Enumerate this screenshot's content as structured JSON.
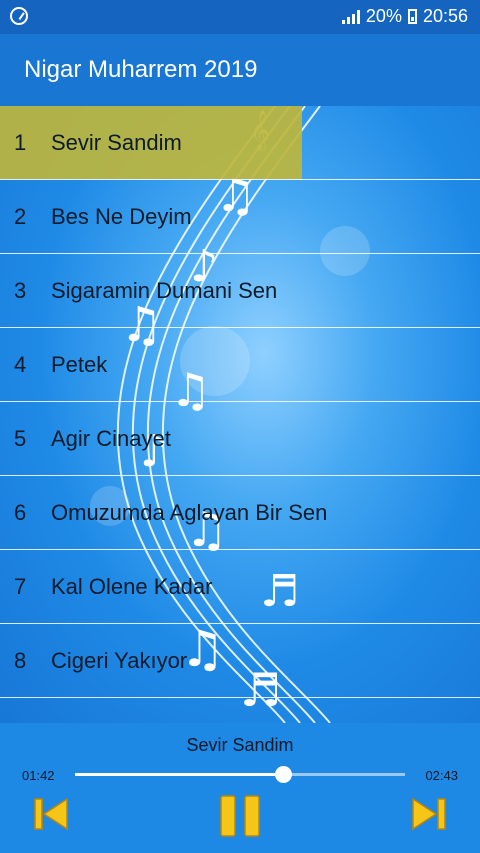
{
  "status_bar": {
    "battery_text": "20%",
    "time": "20:56"
  },
  "app_bar": {
    "title": "Nigar Muharrem 2019"
  },
  "tracks": [
    {
      "num": "1",
      "title": "Sevir Sandim",
      "active": true
    },
    {
      "num": "2",
      "title": "Bes Ne Deyim",
      "active": false
    },
    {
      "num": "3",
      "title": "Sigaramin Dumani Sen",
      "active": false
    },
    {
      "num": "4",
      "title": "Petek",
      "active": false
    },
    {
      "num": "5",
      "title": "Agir Cinayet",
      "active": false
    },
    {
      "num": "6",
      "title": "Omuzumda Aglayan Bir Sen",
      "active": false
    },
    {
      "num": "7",
      "title": "Kal Olene Kadar",
      "active": false
    },
    {
      "num": "8",
      "title": "Cigeri Yakıyor",
      "active": false
    }
  ],
  "player": {
    "now_playing": "Sevir Sandim",
    "current_time": "01:42",
    "total_time": "02:43",
    "progress": 0.63,
    "icons": [
      "skip-previous-icon",
      "pause-icon",
      "skip-next-icon"
    ]
  },
  "colors": {
    "accent": "#1976d2",
    "status_bar": "#1565c0",
    "highlight": "#bdb63c",
    "player_icons": "#f5c518"
  }
}
